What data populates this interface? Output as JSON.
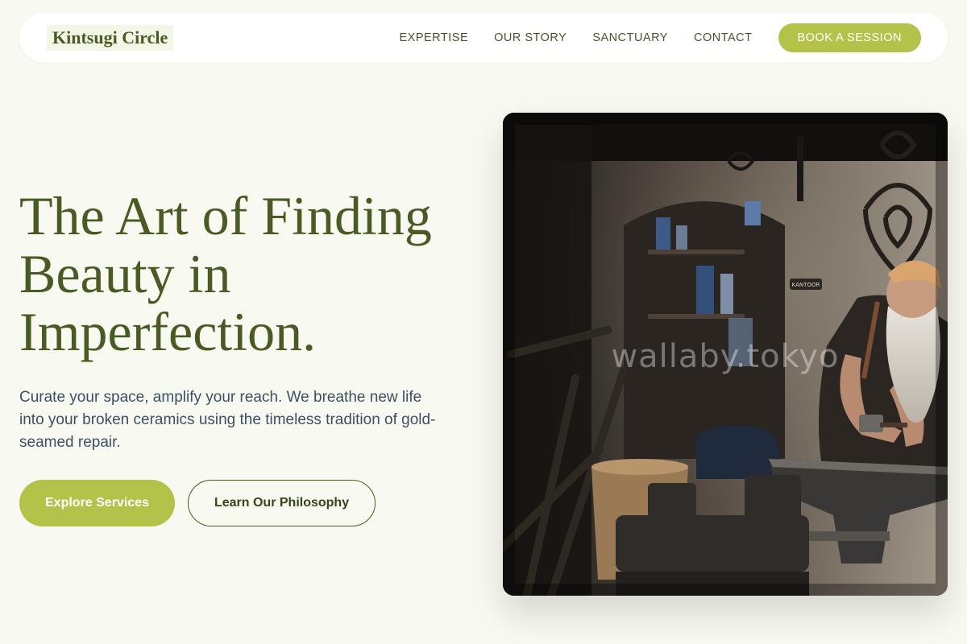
{
  "header": {
    "logo": "Kintsugi Circle",
    "nav": [
      {
        "label": "EXPERTISE"
      },
      {
        "label": "OUR STORY"
      },
      {
        "label": "SANCTUARY"
      },
      {
        "label": "CONTACT"
      }
    ],
    "cta_label": "BOOK A SESSION"
  },
  "hero": {
    "title_lines": [
      "The Art of Finding",
      "Beauty in",
      "Imperfection."
    ],
    "subtitle": "Curate your space, amplify your reach. We breathe new life into your broken ceramics using the timeless tradition of gold-seamed repair.",
    "primary_cta": "Explore Services",
    "secondary_cta": "Learn Our Philosophy"
  },
  "image": {
    "sign_text": "KANTOOR",
    "watermark": "wallaby.tokyo"
  },
  "colors": {
    "accent": "#b3c249",
    "brand_text": "#4a5a24",
    "background": "#f8f9f0",
    "body_text": "#3e4f63"
  }
}
